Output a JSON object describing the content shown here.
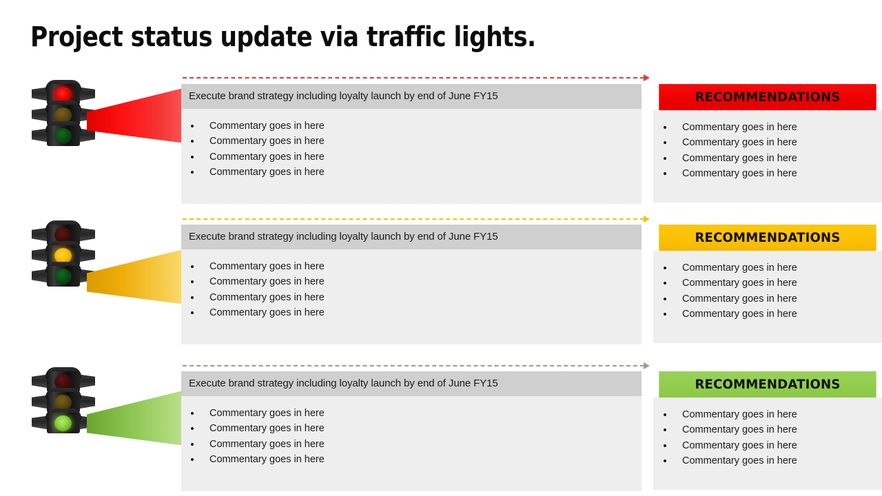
{
  "slide": {
    "title": "Project status update via traffic lights."
  },
  "colors": {
    "red": "#ee0000",
    "amber": "#fbc108",
    "green": "#92cd4e",
    "header_band": "#cfcfcf",
    "body_panel": "#eeeeee",
    "text": "#1a1a1a"
  },
  "rows": [
    {
      "id": "red",
      "status": "red",
      "traffic_light": {
        "lit_lamp": "red",
        "lamps": [
          "red",
          "amber",
          "green"
        ]
      },
      "beam_color": "#ff1111",
      "connector_color": "#e03a3a",
      "card": {
        "header": "Execute brand strategy including loyalty launch by end of June FY15",
        "bullets": [
          "Commentary goes in here",
          "Commentary goes in here",
          "Commentary goes in here",
          "Commentary goes in here"
        ]
      },
      "recommendations": {
        "banner": "RECOMMENDATIONS",
        "banner_color": "#ee0000",
        "bullets": [
          "Commentary goes in here",
          "Commentary goes in here",
          "Commentary goes in here",
          "Commentary goes in here"
        ]
      }
    },
    {
      "id": "amber",
      "status": "amber",
      "traffic_light": {
        "lit_lamp": "amber",
        "lamps": [
          "red",
          "amber",
          "green"
        ]
      },
      "beam_color": "#f0ad0b",
      "connector_color": "#f2c400",
      "card": {
        "header": "Execute brand strategy including loyalty launch by end of June FY15",
        "bullets": [
          "Commentary goes in here",
          "Commentary goes in here",
          "Commentary goes in here",
          "Commentary goes in here"
        ]
      },
      "recommendations": {
        "banner": "RECOMMENDATIONS",
        "banner_color": "#fbc108",
        "bullets": [
          "Commentary goes in here",
          "Commentary goes in here",
          "Commentary goes in here",
          "Commentary goes in here"
        ]
      }
    },
    {
      "id": "green",
      "status": "green",
      "traffic_light": {
        "lit_lamp": "green",
        "lamps": [
          "red",
          "amber",
          "green"
        ]
      },
      "beam_color": "#86c04a",
      "connector_color": "#9aa08c",
      "card": {
        "header": "Execute brand strategy including loyalty launch by end of June FY15",
        "bullets": [
          "Commentary goes in here",
          "Commentary goes in here",
          "Commentary goes in here",
          "Commentary goes in here"
        ]
      },
      "recommendations": {
        "banner": "RECOMMENDATIONS",
        "banner_color": "#92cd4e",
        "bullets": [
          "Commentary goes in here",
          "Commentary goes in here",
          "Commentary goes in here",
          "Commentary goes in here"
        ]
      }
    }
  ]
}
